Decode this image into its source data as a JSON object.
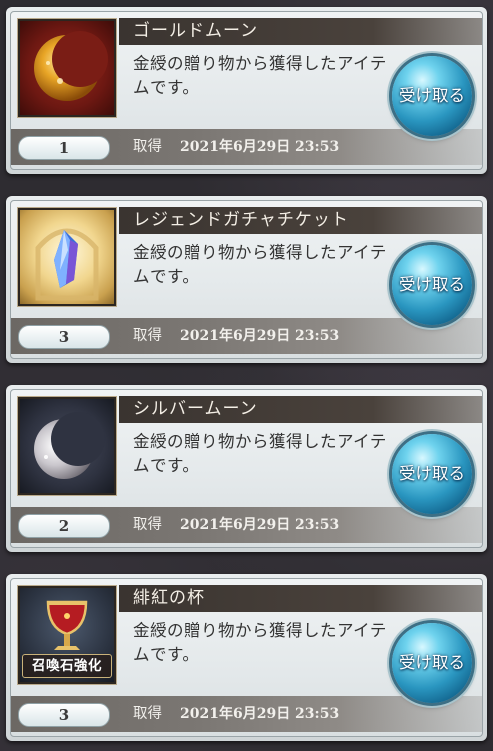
{
  "colors": {
    "button_blue": "#2a96c0",
    "title_bar": "#3a3430",
    "card_bg": "#e9edee"
  },
  "items": [
    {
      "name": "ゴールドムーン",
      "description": "金綬の贈り物から獲得したアイテムです。",
      "quantity": "1",
      "acquired_label": "取得",
      "acquired_date": "2021年6月29日 23:53",
      "receive_label": "受け取る",
      "icon": "gold-moon-icon"
    },
    {
      "name": "レジェンドガチャチケット",
      "description": "金綬の贈り物から獲得したアイテムです。",
      "quantity": "3",
      "acquired_label": "取得",
      "acquired_date": "2021年6月29日 23:53",
      "receive_label": "受け取る",
      "icon": "legend-ticket-icon"
    },
    {
      "name": "シルバームーン",
      "description": "金綬の贈り物から獲得したアイテムです。",
      "quantity": "2",
      "acquired_label": "取得",
      "acquired_date": "2021年6月29日 23:53",
      "receive_label": "受け取る",
      "icon": "silver-moon-icon"
    },
    {
      "name": "緋紅の杯",
      "description": "金綬の贈り物から獲得したアイテムです。",
      "quantity": "3",
      "acquired_label": "取得",
      "acquired_date": "2021年6月29日 23:53",
      "receive_label": "受け取る",
      "icon": "crimson-chalice-icon",
      "badge": "召喚石強化"
    }
  ]
}
